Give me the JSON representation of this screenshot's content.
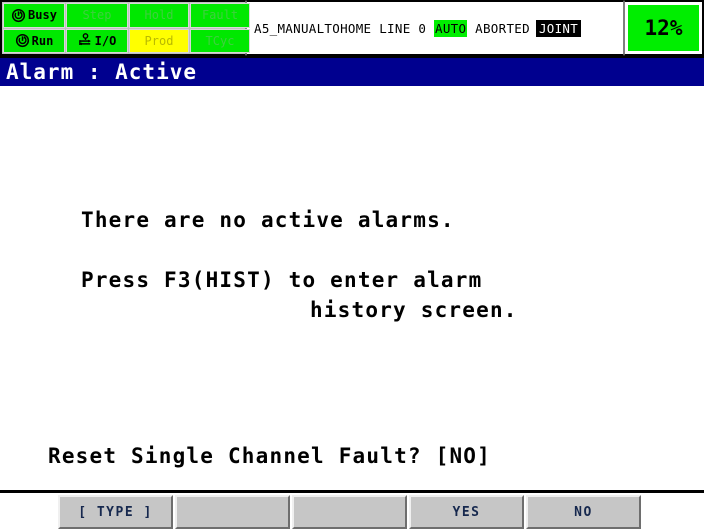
{
  "header": {
    "indicators": [
      {
        "label": "Busy",
        "state": "on",
        "color": "#00e800",
        "icon": "cycle-arrow-icon"
      },
      {
        "label": "Step",
        "state": "off",
        "color": "#00e800",
        "icon": ""
      },
      {
        "label": "Hold",
        "state": "off",
        "color": "#00e800",
        "icon": ""
      },
      {
        "label": "Fault",
        "state": "off",
        "color": "#00e800",
        "icon": ""
      },
      {
        "label": "Run",
        "state": "on",
        "color": "#00e800",
        "icon": "cycle-arrow-icon"
      },
      {
        "label": "I/O",
        "state": "on",
        "color": "#00e800",
        "icon": "io-exchange-icon"
      },
      {
        "label": "Prod",
        "state": "off",
        "color": "#ffff00",
        "icon": ""
      },
      {
        "label": "TCyc",
        "state": "off",
        "color": "#00e800",
        "icon": ""
      }
    ],
    "status": {
      "program_name": "A5_MANUALTOHOME",
      "line_label": "LINE",
      "line_number": "0",
      "mode": "AUTO",
      "run_state": "ABORTED",
      "coord_system": "JOINT",
      "full_text": "A5_MANUALTOHOME LINE 0 AUTO ABORTED JOINT"
    },
    "override": {
      "value": "12%",
      "background": "#00ee00"
    }
  },
  "title_bar": {
    "text": "Alarm : Active",
    "background": "#00008f",
    "foreground": "#ffffff"
  },
  "screen": {
    "message": "There are no active alarms.",
    "hint_line1": "Press F3(HIST) to enter alarm",
    "hint_line2": "history screen.",
    "prompt": "Reset Single Channel Fault? [NO]"
  },
  "function_keys": [
    {
      "label": "[ TYPE ]"
    },
    {
      "label": ""
    },
    {
      "label": ""
    },
    {
      "label": "YES"
    },
    {
      "label": "NO"
    }
  ]
}
